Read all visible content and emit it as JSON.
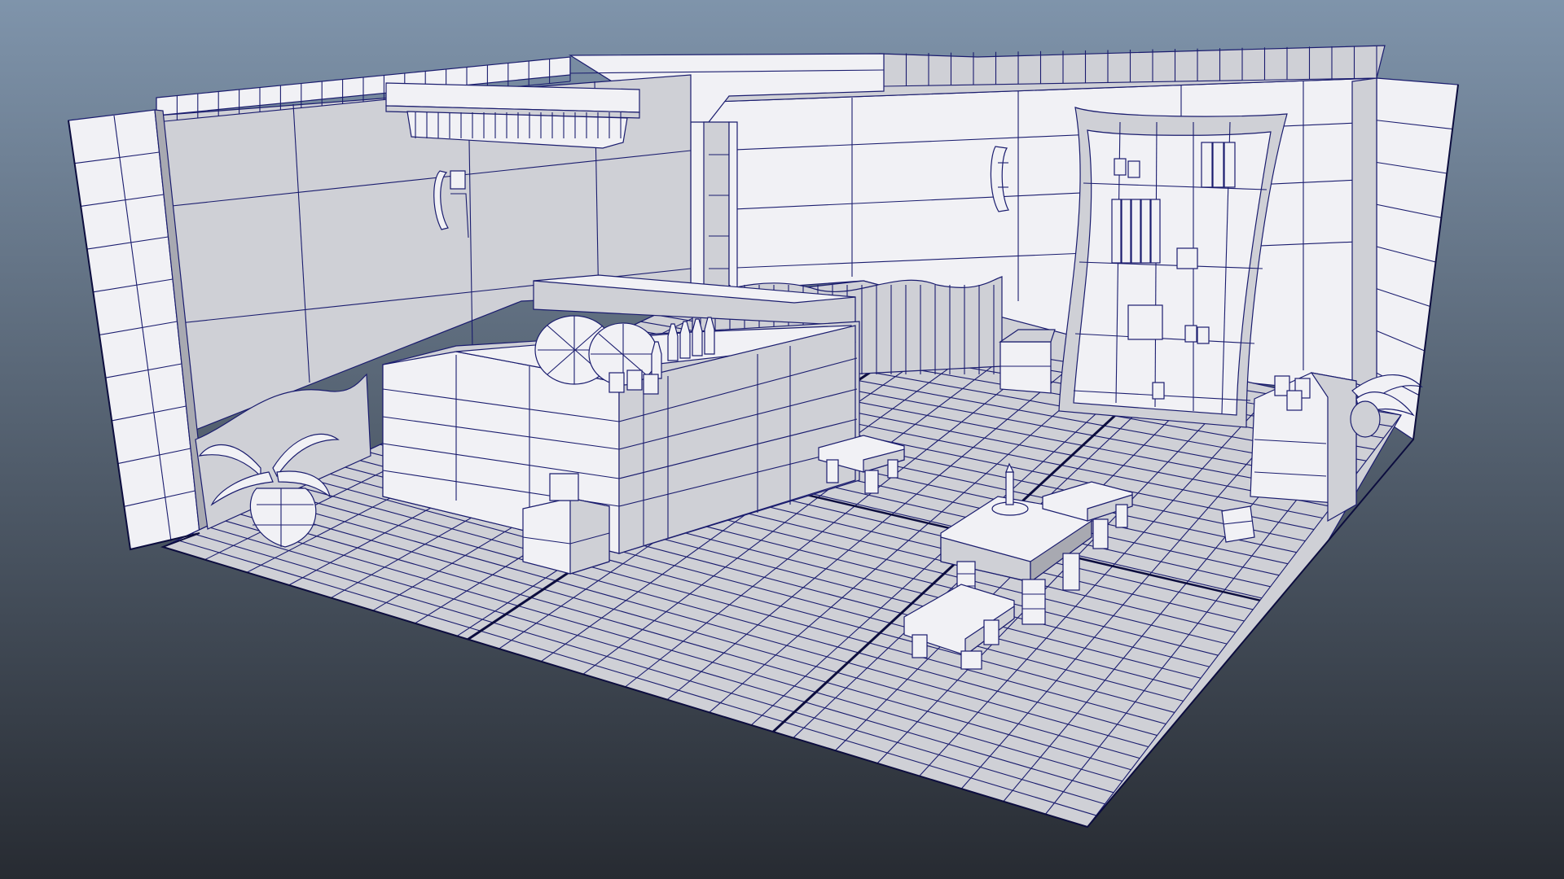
{
  "viewport": {
    "background_top": "#7f94ab",
    "background_bottom": "#272b32",
    "shade_light": "#f1f1f5",
    "shade_mid": "#cfd0d6",
    "shade_dark": "#a8a9b1",
    "wire_color": "#1a1c6e",
    "frame_color": "#0c0d3e"
  },
  "scene": {
    "objects": [
      "room-floor",
      "back-wall",
      "left-wall",
      "right-wall",
      "ceiling-beam",
      "awning",
      "bar-counter",
      "barrel-left",
      "barrel-right",
      "bottle-cluster",
      "mug-cluster",
      "bookshelf",
      "shelf-crate",
      "wall-crate-right",
      "potted-plant-left",
      "potted-plant-right",
      "wall-lamp-left",
      "wall-lamp-right",
      "table",
      "candle",
      "stool-1",
      "stool-2",
      "stool-3",
      "small-crate-left",
      "small-crate-right"
    ]
  }
}
